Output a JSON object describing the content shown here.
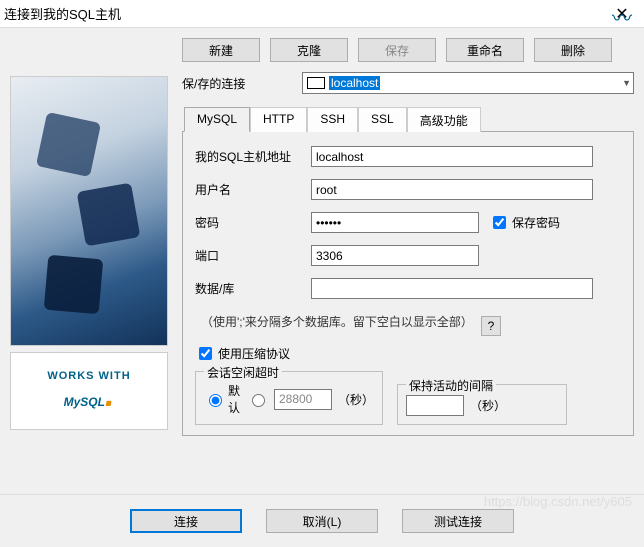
{
  "window": {
    "title": "连接到我的SQL主机"
  },
  "topButtons": {
    "new": "新建",
    "clone": "克隆",
    "save": "保存",
    "rename": "重命名",
    "delete": "删除"
  },
  "savedConn": {
    "label": "保/存的连接",
    "selected": "localhost"
  },
  "tabs": {
    "mysql": "MySQL",
    "http": "HTTP",
    "ssh": "SSH",
    "ssl": "SSL",
    "advanced": "高级功能"
  },
  "fields": {
    "hostLabel": "我的SQL主机地址",
    "host": "localhost",
    "userLabel": "用户名",
    "user": "root",
    "passLabel": "密码",
    "pass": "••••••",
    "savePass": "保存密码",
    "portLabel": "端口",
    "port": "3306",
    "dbLabel": "数据/库",
    "db": "",
    "hint": "（使用';'来分隔多个数据库。留下空白以显示全部）",
    "help": "?",
    "compress": "使用压缩协议"
  },
  "idle": {
    "title": "会话空闲超时",
    "default": "默认",
    "value": "28800",
    "unit": "（秒）"
  },
  "keepalive": {
    "title": "保持活动的间隔",
    "value": "",
    "unit": "（秒）"
  },
  "footer": {
    "connect": "连接",
    "cancel": "取消(L)",
    "test": "测试连接"
  },
  "logo": {
    "works": "WORKS WITH",
    "mysql": "MySQL"
  },
  "watermark": "https://blog.csdn.net/y605"
}
